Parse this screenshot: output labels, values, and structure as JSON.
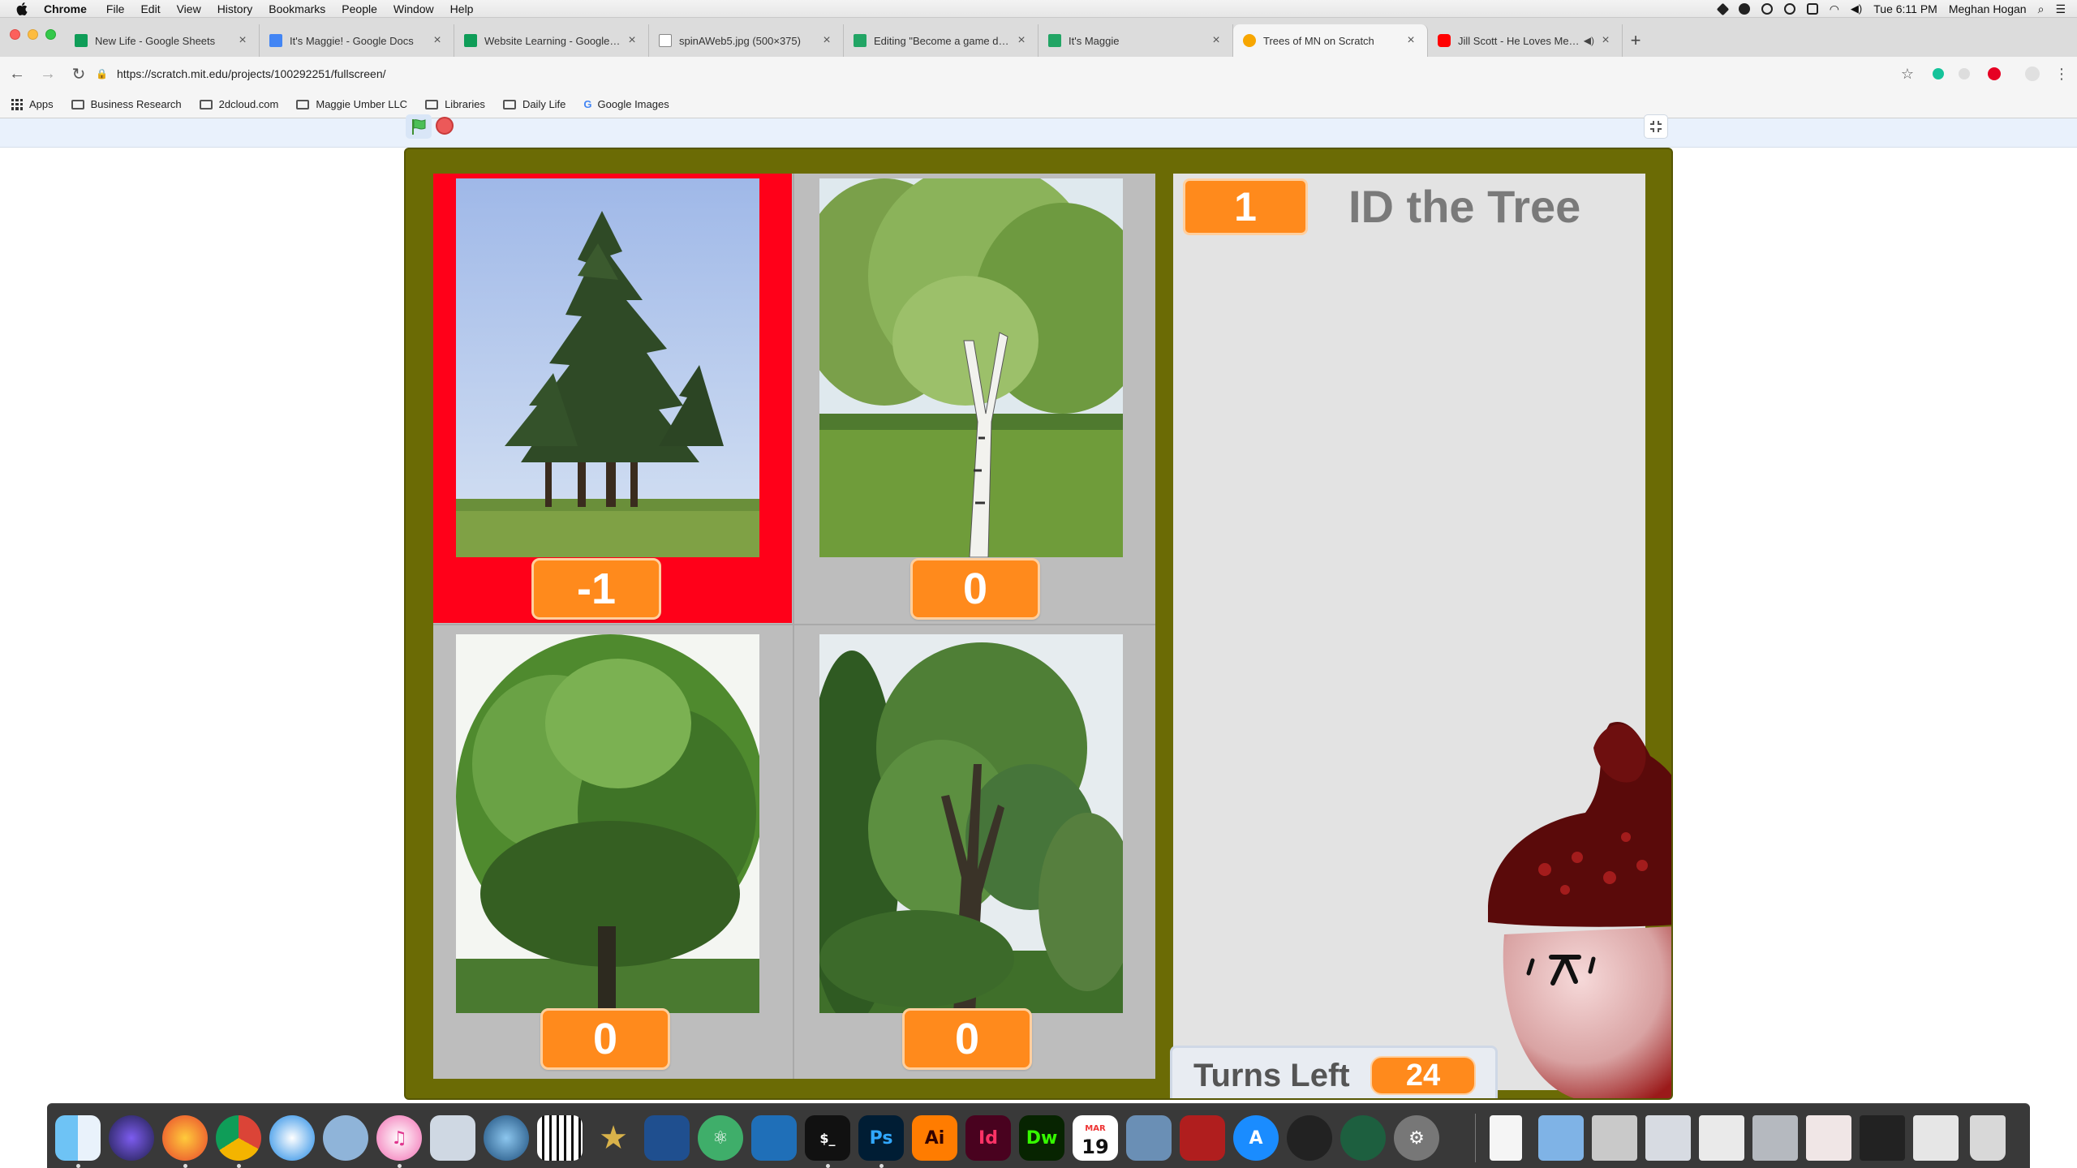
{
  "menubar": {
    "app_name": "Chrome",
    "items": [
      "File",
      "Edit",
      "View",
      "History",
      "Bookmarks",
      "People",
      "Window",
      "Help"
    ],
    "clock": "Tue 6:11 PM",
    "user": "Meghan Hogan"
  },
  "tabs": [
    {
      "title": "New Life - Google Sheets",
      "favicon": "sheets-icon",
      "color": "#0f9d58"
    },
    {
      "title": "It's Maggie! - Google Docs",
      "favicon": "docs-icon",
      "color": "#4285f4"
    },
    {
      "title": "Website Learning - Google She",
      "favicon": "sheets-icon",
      "color": "#0f9d58"
    },
    {
      "title": "spinAWeb5.jpg (500×375)",
      "favicon": "page-icon",
      "color": "#9aa0a6"
    },
    {
      "title": "Editing \"Become a game desig",
      "favicon": "sites-icon",
      "color": "#22a565"
    },
    {
      "title": "It's Maggie",
      "favicon": "sites-icon",
      "color": "#22a565"
    },
    {
      "title": "Trees of MN on Scratch",
      "favicon": "scratch-icon",
      "color": "#f7a600",
      "active": true
    },
    {
      "title": "Jill Scott - He Loves Me (Li",
      "favicon": "youtube-icon",
      "color": "#ff0000",
      "audio": true
    }
  ],
  "toolbar": {
    "url": "https://scratch.mit.edu/projects/100292251/fullscreen/"
  },
  "bookmarks": [
    {
      "label": "Apps",
      "type": "apps"
    },
    {
      "label": "Business Research",
      "type": "folder"
    },
    {
      "label": "2dcloud.com",
      "type": "folder"
    },
    {
      "label": "Maggie Umber LLC",
      "type": "folder"
    },
    {
      "label": "Libraries",
      "type": "folder"
    },
    {
      "label": "Daily Life",
      "type": "folder"
    },
    {
      "label": "Google Images",
      "type": "google"
    }
  ],
  "game": {
    "title": "ID the Tree",
    "level": "1",
    "turns_label": "Turns Left",
    "turns_value": "24",
    "cards": [
      {
        "name": "white-pine",
        "score": "-1",
        "selected": true
      },
      {
        "name": "paper-birch",
        "score": "0",
        "selected": false
      },
      {
        "name": "bur-oak",
        "score": "0",
        "selected": false
      },
      {
        "name": "elm",
        "score": "0",
        "selected": false
      }
    ],
    "colors": {
      "stage_border": "#6b6b05",
      "score_box": "#ff8a1c",
      "selected": "#ff0019",
      "panel": "#e3e3e3"
    }
  },
  "dock": {
    "icons": [
      "finder-icon",
      "siri-icon",
      "firefox-icon",
      "chrome-icon",
      "safari-icon",
      "screenshot-icon",
      "itunes-icon",
      "preview-icon",
      "quicktime-icon",
      "piano-icon",
      "star-app-icon",
      "photoshop-dev-icon",
      "atom-icon",
      "vscode-icon",
      "terminal-icon",
      "photoshop-icon",
      "illustrator-icon",
      "indesign-icon",
      "dreamweaver-icon",
      "calendar-icon",
      "image-capture-icon",
      "photo-booth-icon",
      "app-store-icon",
      "speedtest-icon",
      "time-machine-icon",
      "system-preferences-icon"
    ],
    "labels": {
      "photoshop": "Ps",
      "illustrator": "Ai",
      "indesign": "Id",
      "dreamweaver": "Dw",
      "calendar_month": "MAR",
      "calendar_day": "19"
    }
  }
}
